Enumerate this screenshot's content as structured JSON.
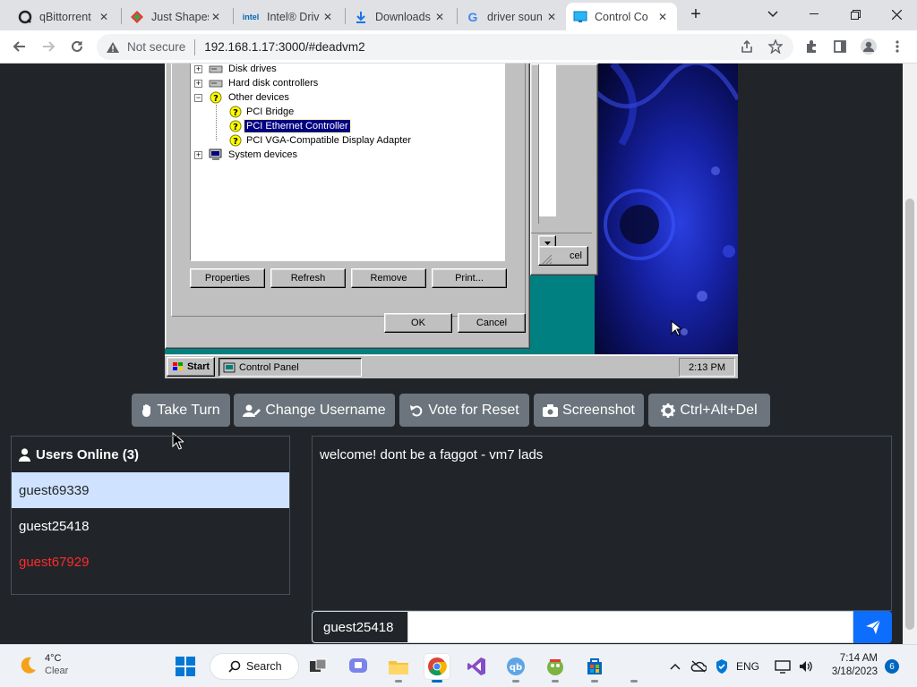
{
  "browser": {
    "tabs": [
      {
        "title": "qBittorrent",
        "favicon": "qbittorrent-icon",
        "active": false
      },
      {
        "title": "Just Shapes",
        "favicon": "just-shapes-icon",
        "active": false
      },
      {
        "title": "Intel® Driv",
        "favicon": "intel-icon",
        "favicon_text": "intel",
        "active": false
      },
      {
        "title": "Downloads",
        "favicon": "download-icon",
        "active": false
      },
      {
        "title": "driver soun",
        "favicon": "google-icon",
        "favicon_text": "G",
        "active": false
      },
      {
        "title": "Control Co",
        "favicon": "monitor-icon",
        "active": true
      }
    ],
    "security_label": "Not secure",
    "url": "192.168.1.17:3000/#deadvm2"
  },
  "vm": {
    "device_tree": [
      {
        "label": "Disk drives",
        "level": 0,
        "expander": "+",
        "icon": "disk-drive-icon"
      },
      {
        "label": "Hard disk controllers",
        "level": 0,
        "expander": "+",
        "icon": "hard-disk-controller-icon"
      },
      {
        "label": "Other devices",
        "level": 0,
        "expander": "−",
        "icon": "question-mark-icon"
      },
      {
        "label": "PCI Bridge",
        "level": 1,
        "icon": "unknown-device-icon"
      },
      {
        "label": "PCI Ethernet Controller",
        "level": 1,
        "icon": "unknown-device-icon",
        "selected": true
      },
      {
        "label": "PCI VGA-Compatible Display Adapter",
        "level": 1,
        "icon": "unknown-device-icon"
      },
      {
        "label": "System devices",
        "level": 0,
        "expander": "+",
        "icon": "computer-icon"
      }
    ],
    "buttons": {
      "properties": "Properties",
      "refresh": "Refresh",
      "remove": "Remove",
      "print": "Print...",
      "ok": "OK",
      "cancel": "Cancel",
      "back_cancel": "cel"
    },
    "taskbar": {
      "start": "Start",
      "task": "Control Panel",
      "clock": "2:13 PM"
    }
  },
  "actions": {
    "take_turn": "Take Turn",
    "change_username": "Change Username",
    "vote_reset": "Vote for Reset",
    "screenshot": "Screenshot",
    "ctrl_alt_del": "Ctrl+Alt+Del"
  },
  "users": {
    "header": "Users Online (3)",
    "list": [
      {
        "name": "guest69339",
        "highlight": true
      },
      {
        "name": "guest25418"
      },
      {
        "name": "guest67929",
        "color": "#ff2a2a"
      }
    ]
  },
  "chat": {
    "messages": [
      "welcome! dont be a faggot - vm7 lads"
    ],
    "username": "guest25418",
    "input_value": ""
  },
  "colors": {
    "accent": "#0d6efd",
    "selection": "#000080",
    "highlight_row": "#cfe2ff"
  },
  "taskbar": {
    "weather": {
      "temp": "4°C",
      "condition": "Clear"
    },
    "search": "Search",
    "language": "ENG",
    "time": "7:14 AM",
    "date": "3/18/2023",
    "notification_count": "6"
  }
}
